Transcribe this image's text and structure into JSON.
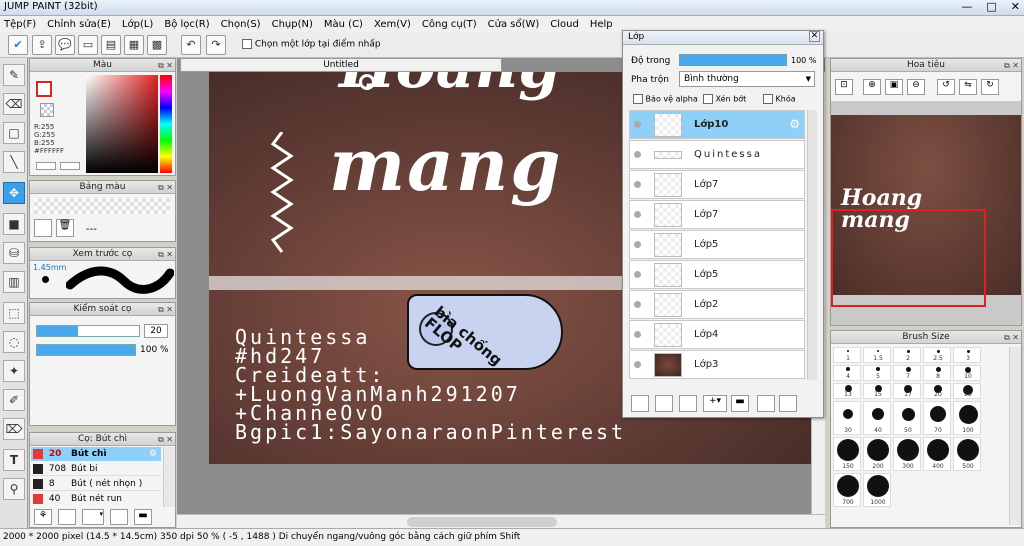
{
  "window": {
    "title": "JUMP PAINT (32bit)",
    "controls": [
      "—",
      "□",
      "✕"
    ]
  },
  "menu": [
    "Tệp(F)",
    "Chỉnh sửa(E)",
    "Lớp(L)",
    "Bộ lọc(R)",
    "Chọn(S)",
    "Chụp(N)",
    "Màu (C)",
    "Xem(V)",
    "Công cụ(T)",
    "Cửa sổ(W)",
    "Cloud",
    "Help"
  ],
  "toolbar": {
    "snap_label": "Chọn một lớp tại điểm nhấp"
  },
  "document": {
    "tab_title": "Untitled"
  },
  "panels": {
    "color": {
      "title": "Màu",
      "r": "R:255",
      "g": "G:255",
      "b": "B:255",
      "hex": "#FFFFFF"
    },
    "palette": {
      "title": "Bảng màu",
      "empty": "---"
    },
    "brush_preview": {
      "title": "Xem trước cọ",
      "size": "1.45mm"
    },
    "brush_control": {
      "title": "Kiểm soát cọ",
      "size_value": "20",
      "opacity_value": "100 %"
    },
    "brush_list": {
      "title": "Cọ: Bút chì",
      "items": [
        {
          "size": "20",
          "name": "Bút chì",
          "color": "#e53935"
        },
        {
          "size": "708",
          "name": "Bút bi",
          "color": "#222222"
        },
        {
          "size": "8",
          "name": "Bút ( nét nhọn )",
          "color": "#222222"
        },
        {
          "size": "40",
          "name": "Bút nét run",
          "color": "#e53935"
        }
      ]
    },
    "navigator": {
      "title": "Hoa tiêu"
    },
    "brush_size": {
      "title": "Brush Size",
      "rows": [
        [
          "1",
          "1.5",
          "2",
          "2.5",
          "3"
        ],
        [
          "4",
          "5",
          "7",
          "8",
          "10"
        ],
        [
          "13",
          "15",
          "17",
          "20",
          "25"
        ],
        [
          "30",
          "40",
          "50",
          "70",
          "100"
        ],
        [
          "150",
          "200",
          "300",
          "400",
          "500"
        ],
        [
          "700",
          "1000"
        ]
      ]
    }
  },
  "layers": {
    "title": "Lớp",
    "opacity_label": "Độ trong",
    "opacity_value": "100 %",
    "blend_label": "Pha trộn",
    "blend_value": "Bình thường",
    "protect_alpha": "Bảo vệ alpha",
    "clip": "Xén bớt",
    "lock": "Khóa",
    "items": [
      {
        "name": "Lớp10",
        "selected": true
      },
      {
        "name": "Quintessa",
        "selected": false
      },
      {
        "name": "Lớp7",
        "selected": false
      },
      {
        "name": "Lớp7",
        "selected": false
      },
      {
        "name": "Lớp5",
        "selected": false
      },
      {
        "name": "Lớp5",
        "selected": false
      },
      {
        "name": "Lớp2",
        "selected": false
      },
      {
        "name": "Lớp4",
        "selected": false
      },
      {
        "name": "Lớp3",
        "selected": false
      }
    ]
  },
  "artwork": {
    "big_text_1": "Hoang",
    "big_text_2": "mang",
    "credits": "Quintessa\n#hd247\nCreideatt:\n+LuongVanManh291207\n+ChanneOvO\nBgpic1:SayonaraonPinterest",
    "tag_text": "bìa chống FLOP"
  },
  "status": {
    "size": "2000 * 2000 pixel",
    "cm": "(14.5 * 14.5cm)",
    "dpi": "350 dpi",
    "zoom": "50 %",
    "coords": "( -5 , 1488 )",
    "hint": "Di chuyển ngang/vuông góc bằng cách giữ phím Shift"
  }
}
